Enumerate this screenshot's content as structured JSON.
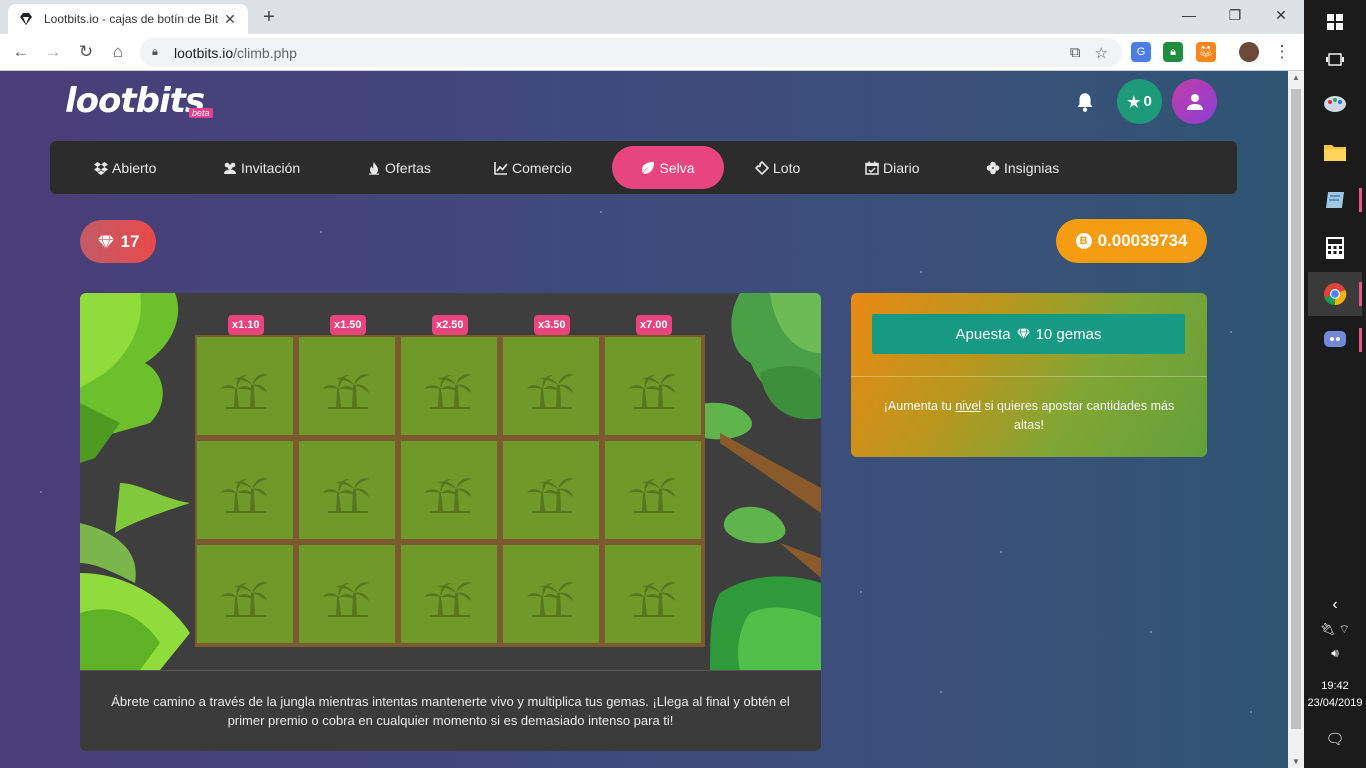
{
  "browser": {
    "tab_title": "Lootbits.io - cajas de botín de Bit",
    "tab_close": "✕",
    "new_tab": "+",
    "url_domain": "lootbits.io",
    "url_path": "/climb.php",
    "window_controls": {
      "minimize": "—",
      "maximize": "❐",
      "close": "✕"
    }
  },
  "site": {
    "logo": "lootbits",
    "beta": "beta",
    "stars_count": "0",
    "gems": "17",
    "balance": "0.00039734",
    "btc_symbol": "B"
  },
  "nav": {
    "items": [
      {
        "label": "Abierto",
        "icon": "dropbox-icon"
      },
      {
        "label": "Invitación",
        "icon": "users-icon"
      },
      {
        "label": "Ofertas",
        "icon": "fire-icon"
      },
      {
        "label": "Comercio",
        "icon": "chart-line-icon"
      },
      {
        "label": "Selva",
        "icon": "leaf-icon",
        "active": true
      },
      {
        "label": "Loto",
        "icon": "ticket-icon"
      },
      {
        "label": "Diario",
        "icon": "calendar-check-icon"
      },
      {
        "label": "Insignias",
        "icon": "clover-icon"
      }
    ]
  },
  "game": {
    "multipliers": [
      "x1.10",
      "x1.50",
      "x2.50",
      "x3.50",
      "x7.00"
    ],
    "description": "Ábrete camino a través de la jungla mientras intentas mantenerte vivo y multiplica tus gemas. ¡Llega al final y obtén el primer premio o cobra en cualquier momento si es demasiado intenso para ti!"
  },
  "bet": {
    "button_prefix": "Apuesta",
    "button_amount": "10 gemas",
    "note_before": "¡Aumenta tu ",
    "note_link": "nivel",
    "note_after": " si quieres apostar cantidades más altas!"
  },
  "taskbar": {
    "time": "19:42",
    "date": "23/04/2019"
  },
  "colors": {
    "accent_pink": "#e8447e",
    "btc_orange": "#f59c12",
    "bet_teal": "#169a84",
    "jungle_green": "#6f9a2a"
  }
}
